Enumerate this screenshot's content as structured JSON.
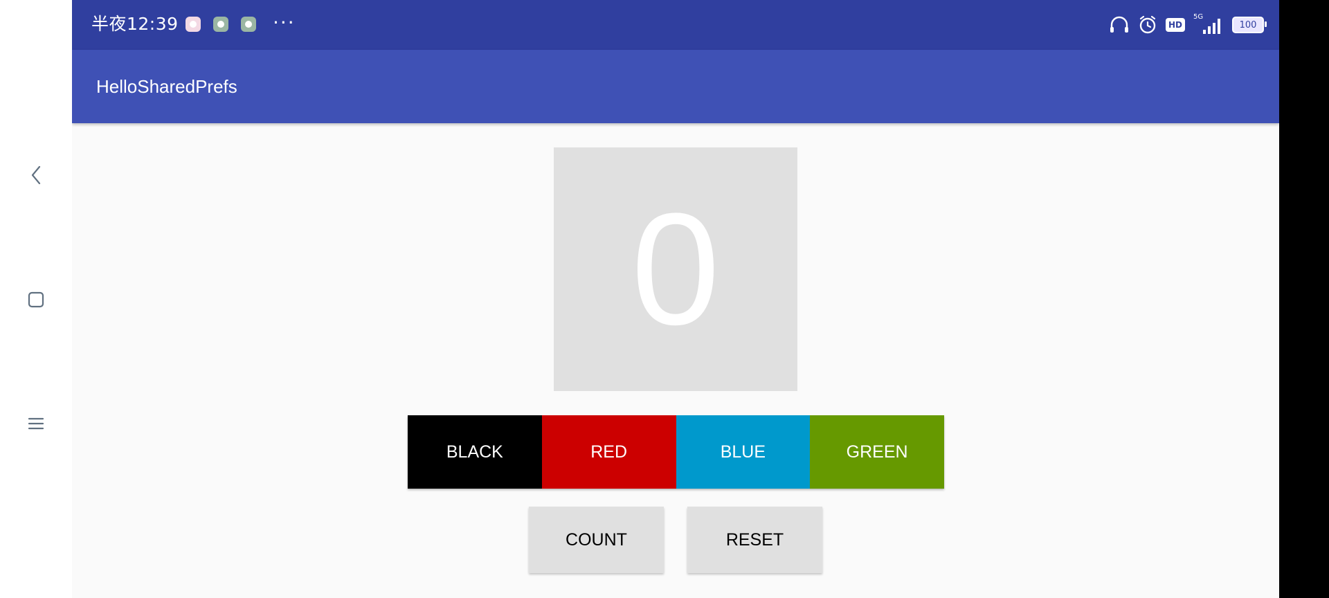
{
  "nav": {
    "back_icon": "chevron-left-icon",
    "home_icon": "square-icon",
    "menu_icon": "hamburger-icon"
  },
  "status_bar": {
    "time": "半夜12:39",
    "more": "···",
    "icons": [
      "headset-icon",
      "alarm-icon",
      "hd-icon",
      "5g-signal-icon",
      "battery-icon"
    ],
    "hd_label": "HD",
    "network_label": "5G",
    "battery_level": "100",
    "bg_color": "#303f9f"
  },
  "app_bar": {
    "title": "HelloSharedPrefs",
    "bg_color": "#3f51b5"
  },
  "counter": {
    "value": "0",
    "bg_color": "#e0e0e0"
  },
  "color_buttons": [
    {
      "label": "BLACK",
      "color": "#000000"
    },
    {
      "label": "RED",
      "color": "#cc0000"
    },
    {
      "label": "BLUE",
      "color": "#0099cc"
    },
    {
      "label": "GREEN",
      "color": "#669900"
    }
  ],
  "actions": {
    "count_label": "COUNT",
    "reset_label": "RESET"
  }
}
